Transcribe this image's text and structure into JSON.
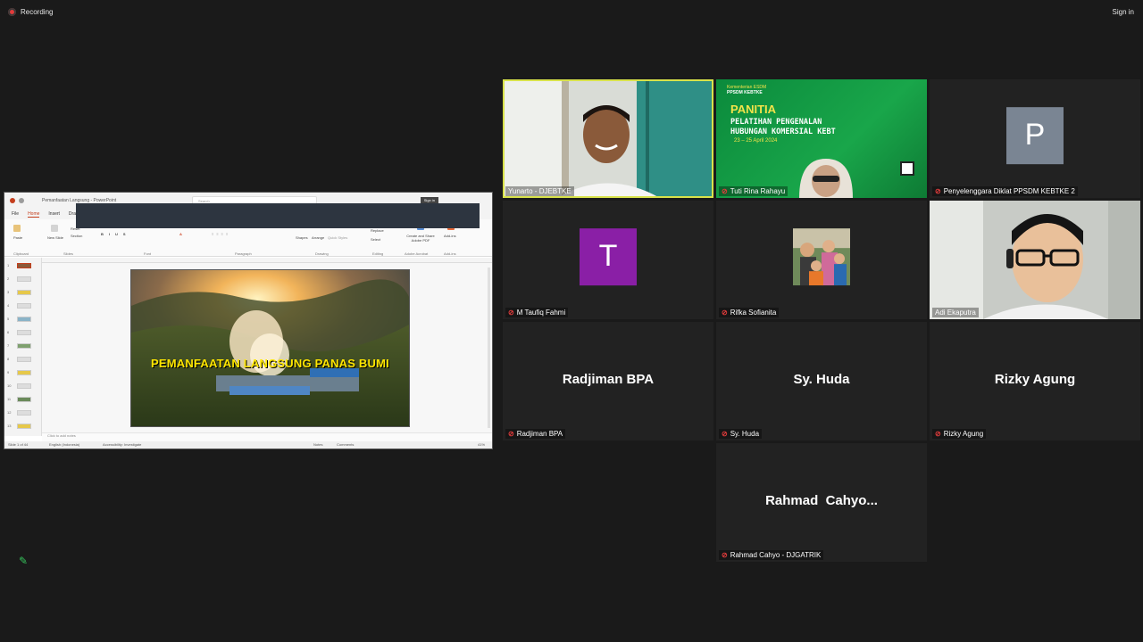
{
  "app": {
    "recording_label": "Recording",
    "signin_label": "Sign in"
  },
  "share": {
    "window_title": "Pemanfaatan Langsung - PowerPoint",
    "search_placeholder": "Search",
    "signin": "Sign in",
    "tabs": [
      "File",
      "Home",
      "Insert",
      "Dra"
    ],
    "ribbon_groups": [
      "Clipboard",
      "Slides",
      "Font",
      "Paragraph",
      "Drawing",
      "Editing",
      "Adobe Acrobat",
      "Add-ins"
    ],
    "ribbon_items": {
      "paste": "Paste",
      "new_slide": "New Slide",
      "reset": "Reset",
      "section": "Section",
      "shapes": "Shapes",
      "arrange": "Arrange",
      "quick_styles": "Quick Styles",
      "replace": "Replace",
      "select": "Select",
      "create_share": "Create and Share Adobe PDF",
      "addins": "Add-ins"
    },
    "slide_numbers": [
      "1",
      "2",
      "3",
      "4",
      "5",
      "6",
      "7",
      "8",
      "9",
      "10",
      "11",
      "12",
      "13"
    ],
    "slide_title": "PEMANFAATAN LANGSUNG PANAS BUMI",
    "notes_placeholder": "Click to add notes",
    "status": {
      "slide_of": "Slide 1 of 44",
      "language": "English (Indonesia)",
      "accessibility": "Accessibility: Investigate",
      "notes": "Notes",
      "comments": "Comments",
      "zoom": "41%"
    }
  },
  "tiles": [
    {
      "name": "Yunarto - DJEBTKE",
      "muted": false,
      "type": "video"
    },
    {
      "name": "Tuti Rina Rahayu",
      "muted": true,
      "type": "video",
      "banner": {
        "org1": "Kementerian ESDM",
        "org2": "PPSDM KEBTKE",
        "title": "PANITIA",
        "line1": "PELATIHAN PENGENALAN",
        "line2": "HUBUNGAN KOMERSIAL KEBT",
        "dates": "23 – 25 April 2024"
      }
    },
    {
      "name": "Penyelenggara Diklat PPSDM KEBTKE 2",
      "muted": true,
      "type": "avatar",
      "initial": "P",
      "color": "#7a8593"
    },
    {
      "name": "M Taufiq Fahmi",
      "muted": true,
      "type": "avatar",
      "initial": "T",
      "color": "#8a1fa6"
    },
    {
      "name": "Rifka Sofianita",
      "muted": true,
      "type": "photo"
    },
    {
      "name": "Adi Ekaputra",
      "muted": false,
      "type": "video"
    },
    {
      "name": "Radjiman BPA",
      "muted": true,
      "type": "name",
      "display": "Radjiman BPA"
    },
    {
      "name": "Sy. Huda",
      "muted": true,
      "type": "name",
      "display": "Sy. Huda"
    },
    {
      "name": "Rizky Agung",
      "muted": true,
      "type": "name",
      "display": "Rizky Agung"
    },
    {
      "name": "Rahmad Cahyo - DJGATRIK",
      "muted": true,
      "type": "name",
      "display": "Rahmad  Cahyo..."
    }
  ],
  "colors": {
    "background": "#1a1a1a",
    "tile": "#222222",
    "active_speaker": "#d8e24a",
    "mute": "#e43c3c"
  }
}
